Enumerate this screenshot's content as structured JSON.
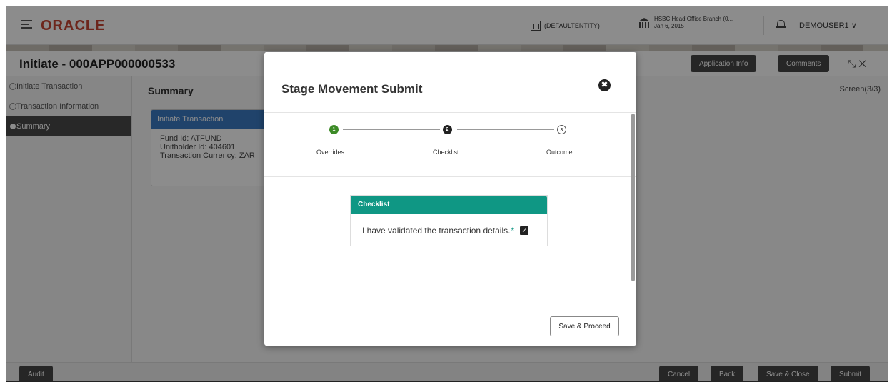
{
  "header": {
    "logo": "ORACLE",
    "entity": "(DEFAULTENTITY)",
    "branch_name": "HSBC Head Office Branch (0...",
    "branch_date": "Jan 6, 2015",
    "user": "DEMOUSER1 ∨"
  },
  "page": {
    "title": "Initiate - 000APP000000533",
    "application_info": "Application Info",
    "comments": "Comments",
    "section_title": "Summary",
    "screen_indicator": "Screen(3/3)"
  },
  "nav": {
    "items": [
      {
        "label": "Initiate Transaction"
      },
      {
        "label": "Transaction Information"
      },
      {
        "label": "Summary"
      }
    ]
  },
  "card": {
    "title": "Initiate Transaction",
    "lines": [
      "Fund Id: ATFUND",
      "Unitholder Id: 404601",
      "Transaction Currency: ZAR"
    ]
  },
  "footer": {
    "audit": "Audit",
    "cancel": "Cancel",
    "back": "Back",
    "save_close": "Save & Close",
    "submit": "Submit"
  },
  "modal": {
    "title": "Stage Movement Submit",
    "close": "✖",
    "steps": [
      {
        "number": "1",
        "label": "Overrides",
        "state": "done"
      },
      {
        "number": "2",
        "label": "Checklist",
        "state": "current"
      },
      {
        "number": "3",
        "label": "Outcome",
        "state": "pending"
      }
    ],
    "checklist": {
      "header": "Checklist",
      "item": "I have validated the transaction details.",
      "required_marker": "*",
      "checked": true,
      "check_mark": "✓"
    },
    "save_proceed": "Save & Proceed"
  },
  "colors": {
    "brand": "#c74634",
    "teal": "#0f9784",
    "step_done": "#3d8b27",
    "dark_button": "#454545"
  }
}
